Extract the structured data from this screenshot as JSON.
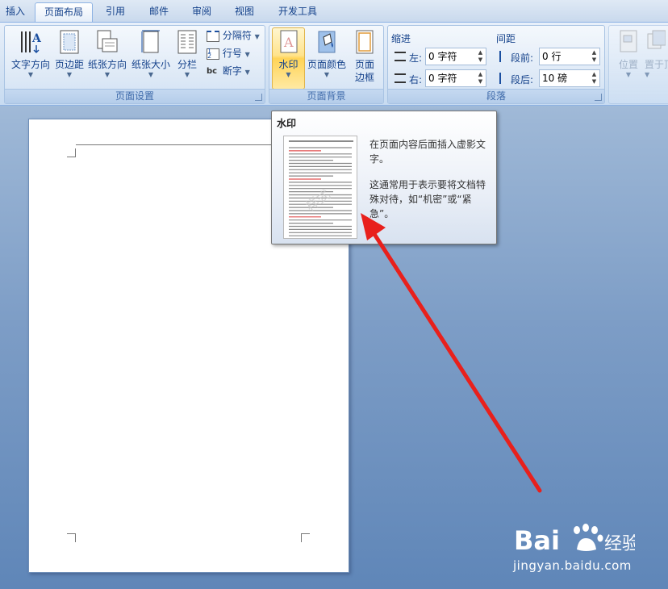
{
  "tabs": [
    {
      "label": "插入",
      "active": false
    },
    {
      "label": "页面布局",
      "active": true
    },
    {
      "label": "引用",
      "active": false
    },
    {
      "label": "邮件",
      "active": false
    },
    {
      "label": "审阅",
      "active": false
    },
    {
      "label": "视图",
      "active": false
    },
    {
      "label": "开发工具",
      "active": false
    }
  ],
  "page_setup": {
    "label": "页面设置",
    "text_direction": "文字方向",
    "margins": "页边距",
    "orientation": "纸张方向",
    "size": "纸张大小",
    "columns": "分栏",
    "breaks": "分隔符",
    "line_numbers": "行号",
    "hyphenation": "断字"
  },
  "page_background": {
    "label": "页面背景",
    "watermark": "水印",
    "page_color": "页面颜色",
    "page_borders_line1": "页面",
    "page_borders_line2": "边框"
  },
  "paragraph": {
    "label": "段落",
    "indent_title": "缩进",
    "spacing_title": "间距",
    "left_label": "左:",
    "left_value": "0 字符",
    "right_label": "右:",
    "right_value": "0 字符",
    "before_label": "段前:",
    "before_value": "0 行",
    "after_label": "段后:",
    "after_value": "10 磅"
  },
  "arrange": {
    "position": "位置",
    "front": "置于顶"
  },
  "tooltip": {
    "title": "水印",
    "line1": "在页面内容后面插入虚影文字。",
    "line2": "这通常用于表示要将文档特殊对待，如“机密”或“紧急”。"
  },
  "watermark": {
    "logo_text": "Bai",
    "logo_text2": "经验",
    "url": "jingyan.baidu.com"
  },
  "colors": {
    "accent_arrow": "#e8201c",
    "highlight": "#ffd457",
    "ribbon_text": "#15428b"
  }
}
